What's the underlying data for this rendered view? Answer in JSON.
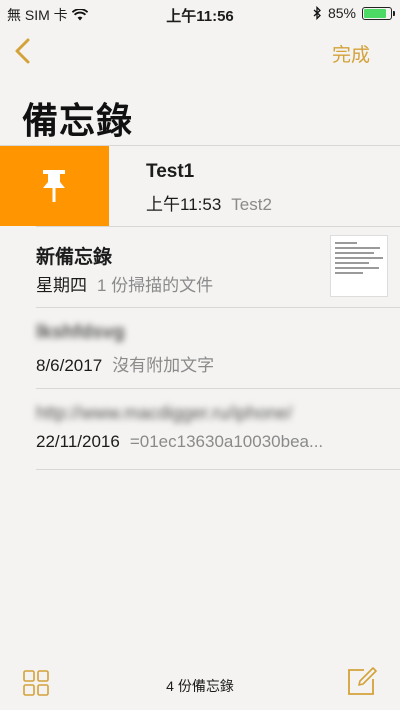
{
  "status": {
    "carrier": "無 SIM 卡",
    "time": "上午11:56",
    "battery": "85%",
    "battery_level": 0.85
  },
  "nav": {
    "done_label": "完成"
  },
  "title": "備忘錄",
  "notes": [
    {
      "title": "Test1",
      "date": "上午11:53",
      "preview": "Test2",
      "pinned": true
    },
    {
      "title": "新備忘錄",
      "date": "星期四",
      "preview": "1 份掃描的文件",
      "has_thumbnail": true
    },
    {
      "title": "lkshfdsvg",
      "date": "8/6/2017",
      "preview": "沒有附加文字"
    },
    {
      "title": "http://www.macdigger.ru/iphone/",
      "date": "22/11/2016",
      "preview": "=01ec13630a10030bea..."
    }
  ],
  "footer": {
    "count": "4 份備忘錄"
  },
  "colors": {
    "accent": "#d4a23a",
    "pin": "#ff9500",
    "battery": "#4cd964"
  }
}
